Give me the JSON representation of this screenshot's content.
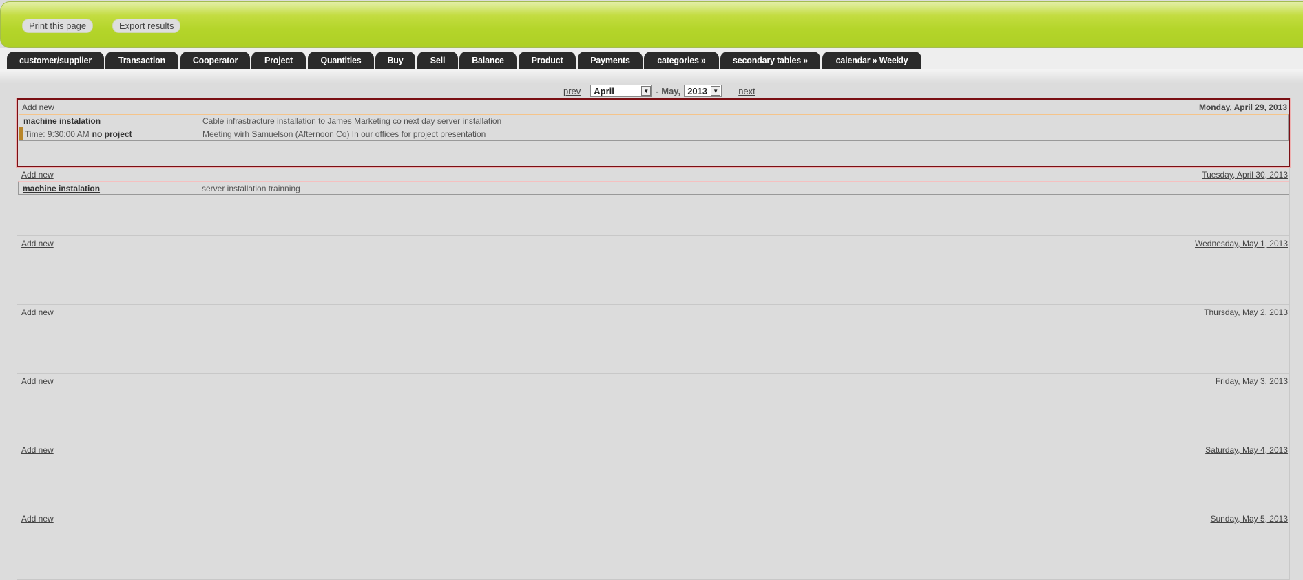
{
  "toolbar": {
    "print": "Print this page",
    "export": "Export results"
  },
  "tabs": [
    "customer/supplier",
    "Transaction",
    "Cooperator",
    "Project",
    "Quantities",
    "Buy",
    "Sell",
    "Balance",
    "Product",
    "Payments",
    "categories »",
    "secondary tables »",
    "calendar » Weekly"
  ],
  "nav": {
    "prev": "prev",
    "month": "April",
    "sep": "- May,",
    "year": "2013",
    "next": "next"
  },
  "days": [
    {
      "date": "Monday, April 29, 2013",
      "add": "Add new",
      "active": true,
      "events": [
        {
          "title": "machine instalation",
          "desc": "Cable infrastracture installation to James Marketing co next day server installation"
        },
        {
          "time": "Time: 9:30:00 AM",
          "project": "no project",
          "desc": "Meeting wirh Samuelson (Afternoon Co) In our offices for project presentation"
        }
      ]
    },
    {
      "date": "Tuesday, April 30, 2013",
      "add": "Add new",
      "events": [
        {
          "title": "machine instalation",
          "desc": "server installation trainning"
        }
      ]
    },
    {
      "date": "Wednesday, May 1, 2013",
      "add": "Add new",
      "events": []
    },
    {
      "date": "Thursday, May 2, 2013",
      "add": "Add new",
      "events": []
    },
    {
      "date": "Friday, May 3, 2013",
      "add": "Add new",
      "events": []
    },
    {
      "date": "Saturday, May 4, 2013",
      "add": "Add new",
      "events": []
    },
    {
      "date": "Sunday, May 5, 2013",
      "add": "Add new",
      "events": []
    }
  ],
  "colors": {
    "header": "#b4d52a",
    "tab": "#2b2b2b",
    "selected_border": "#7a0f14"
  }
}
